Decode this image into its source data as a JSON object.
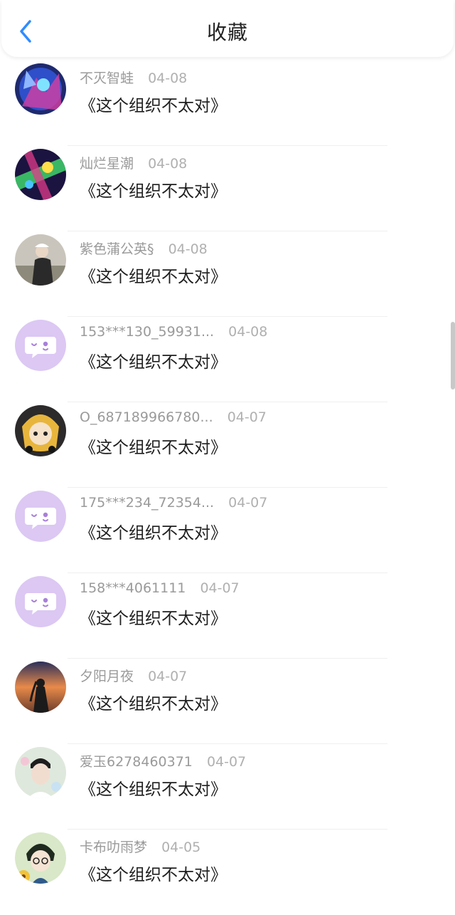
{
  "header": {
    "title": "收藏",
    "back_icon": "chevron-left-icon",
    "accent": "#2f8cff"
  },
  "favorites": [
    {
      "user": "不灭智蛙",
      "date": "04-08",
      "item": "《这个组织不太对》",
      "avatar": "photo"
    },
    {
      "user": "灿烂星潮",
      "date": "04-08",
      "item": "《这个组织不太对》",
      "avatar": "photo"
    },
    {
      "user": "紫色蒲公英§",
      "date": "04-08",
      "item": "《这个组织不太对》",
      "avatar": "photo"
    },
    {
      "user": "153***130_59931...",
      "date": "04-08",
      "item": "《这个组织不太对》",
      "avatar": "default-chat-icon"
    },
    {
      "user": "O_687189966780...",
      "date": "04-07",
      "item": "《这个组织不太对》",
      "avatar": "photo"
    },
    {
      "user": "175***234_72354...",
      "date": "04-07",
      "item": "《这个组织不太对》",
      "avatar": "default-chat-icon"
    },
    {
      "user": "158***4061111",
      "date": "04-07",
      "item": "《这个组织不太对》",
      "avatar": "default-chat-icon"
    },
    {
      "user": "夕阳月夜",
      "date": "04-07",
      "item": "《这个组织不太对》",
      "avatar": "photo"
    },
    {
      "user": "爱玉6278460371",
      "date": "04-07",
      "item": "《这个组织不太对》",
      "avatar": "photo"
    },
    {
      "user": "卡布叻雨梦",
      "date": "04-05",
      "item": "《这个组织不太对》",
      "avatar": "photo"
    }
  ],
  "colors": {
    "default_avatar_bg": "#dcc8f3",
    "default_avatar_glyph": "#a880d9"
  }
}
